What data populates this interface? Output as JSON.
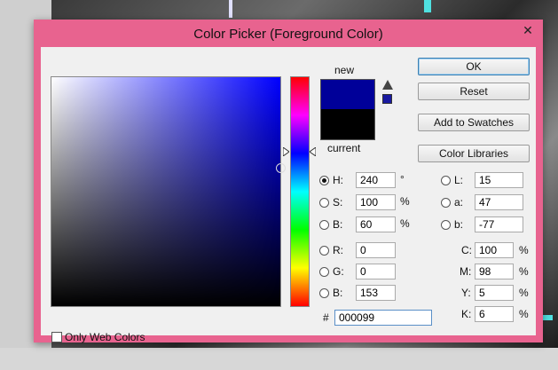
{
  "dialog": {
    "title": "Color Picker (Foreground Color)",
    "close_glyph": "✕"
  },
  "swatches": {
    "new_label": "new",
    "current_label": "current",
    "new_color": "#000099",
    "current_color": "#000000"
  },
  "buttons": {
    "ok": "OK",
    "reset": "Reset",
    "add_to_swatches": "Add to Swatches",
    "color_libraries": "Color Libraries"
  },
  "hsb": {
    "h": {
      "label": "H:",
      "value": "240",
      "unit": "°",
      "selected": true
    },
    "s": {
      "label": "S:",
      "value": "100",
      "unit": "%",
      "selected": false
    },
    "b": {
      "label": "B:",
      "value": "60",
      "unit": "%",
      "selected": false
    }
  },
  "rgb": {
    "r": {
      "label": "R:",
      "value": "0"
    },
    "g": {
      "label": "G:",
      "value": "0"
    },
    "b": {
      "label": "B:",
      "value": "153"
    }
  },
  "lab": {
    "l": {
      "label": "L:",
      "value": "15"
    },
    "a": {
      "label": "a:",
      "value": "47"
    },
    "b": {
      "label": "b:",
      "value": "-77"
    }
  },
  "cmyk": {
    "c": {
      "label": "C:",
      "value": "100",
      "unit": "%"
    },
    "m": {
      "label": "M:",
      "value": "98",
      "unit": "%"
    },
    "y": {
      "label": "Y:",
      "value": "5",
      "unit": "%"
    },
    "k": {
      "label": "K:",
      "value": "6",
      "unit": "%"
    }
  },
  "hex": {
    "label": "#",
    "value": "000099"
  },
  "only_web_colors": {
    "label": "Only Web Colors",
    "checked": false
  },
  "colors": {
    "title_bar": "#e8638f",
    "field_hue": "#0000ff"
  }
}
